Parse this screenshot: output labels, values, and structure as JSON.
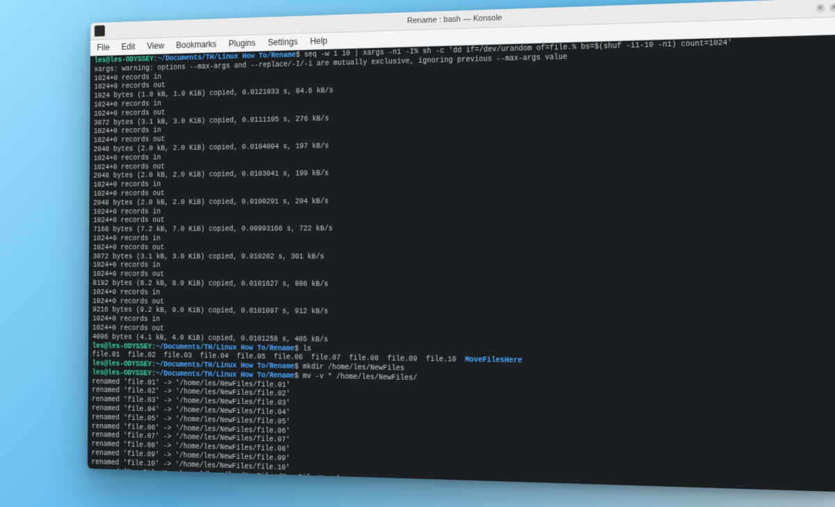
{
  "window": {
    "title": "Rename : bash — Konsole"
  },
  "menu": {
    "file": "File",
    "edit": "Edit",
    "view": "View",
    "bookmarks": "Bookmarks",
    "plugins": "Plugins",
    "settings": "Settings",
    "help": "Help"
  },
  "prompt": {
    "user": "les@les-ODYSSEY",
    "colon": ":",
    "path": "~/Documents/TH/Linux How To/Rename",
    "sym": "$"
  },
  "cmd": {
    "seq": " seq -w 1 10 | xargs -n1 -I% sh -c 'dd if=/dev/urandom of=file.% bs=$(shuf -i1-10 -n1) count=1024'",
    "ls": " ls",
    "mkdir": " mkdir /home/les/NewFiles",
    "mv": " mv -v * /home/les/NewFiles/"
  },
  "out": {
    "l00": "xargs: warning: options --max-args and --replace/-I/-i are mutually exclusive, ignoring previous --max-args value",
    "l01": "1024+0 records in",
    "l02": "1024+0 records out",
    "l03": "1024 bytes (1.0 kB, 1.0 KiB) copied, 0.0121033 s, 84.6 kB/s",
    "l04": "1024+0 records in",
    "l05": "1024+0 records out",
    "l06": "3072 bytes (3.1 kB, 3.0 KiB) copied, 0.0111105 s, 276 kB/s",
    "l07": "1024+0 records in",
    "l08": "1024+0 records out",
    "l09": "2048 bytes (2.0 kB, 2.0 KiB) copied, 0.0104004 s, 197 kB/s",
    "l10": "1024+0 records in",
    "l11": "1024+0 records out",
    "l12": "2048 bytes (2.0 kB, 2.0 KiB) copied, 0.0103041 s, 199 kB/s",
    "l13": "1024+0 records in",
    "l14": "1024+0 records out",
    "l15": "2048 bytes (2.0 kB, 2.0 KiB) copied, 0.0100291 s, 204 kB/s",
    "l16": "1024+0 records in",
    "l17": "1024+0 records out",
    "l18": "7168 bytes (7.2 kB, 7.0 KiB) copied, 0.00993166 s, 722 kB/s",
    "l19": "1024+0 records in",
    "l20": "1024+0 records out",
    "l21": "3072 bytes (3.1 kB, 3.0 KiB) copied, 0.010202 s, 301 kB/s",
    "l22": "1024+0 records in",
    "l23": "1024+0 records out",
    "l24": "8192 bytes (8.2 kB, 8.0 KiB) copied, 0.0101627 s, 806 kB/s",
    "l25": "1024+0 records in",
    "l26": "1024+0 records out",
    "l27": "9216 bytes (9.2 kB, 9.0 KiB) copied, 0.0101097 s, 912 kB/s",
    "l28": "1024+0 records in",
    "l29": "1024+0 records out",
    "l30": "4096 bytes (4.1 kB, 4.0 KiB) copied, 0.0101258 s, 405 kB/s"
  },
  "ls": {
    "files": "file.01  file.02  file.03  file.04  file.05  file.06  file.07  file.08  file.09  file.10  ",
    "dir": "MoveFilesHere"
  },
  "mv": {
    "r01": "renamed 'file.01' -> '/home/les/NewFiles/file.01'",
    "r02": "renamed 'file.02' -> '/home/les/NewFiles/file.02'",
    "r03": "renamed 'file.03' -> '/home/les/NewFiles/file.03'",
    "r04": "renamed 'file.04' -> '/home/les/NewFiles/file.04'",
    "r05": "renamed 'file.05' -> '/home/les/NewFiles/file.05'",
    "r06": "renamed 'file.06' -> '/home/les/NewFiles/file.06'",
    "r07": "renamed 'file.07' -> '/home/les/NewFiles/file.07'",
    "r08": "renamed 'file.08' -> '/home/les/NewFiles/file.08'",
    "r09": "renamed 'file.09' -> '/home/les/NewFiles/file.09'",
    "r10": "renamed 'file.10' -> '/home/les/NewFiles/file.10'",
    "r11": "renamed 'MoveFilesHere' -> '/home/les/NewFiles/MoveFilesHere'"
  }
}
